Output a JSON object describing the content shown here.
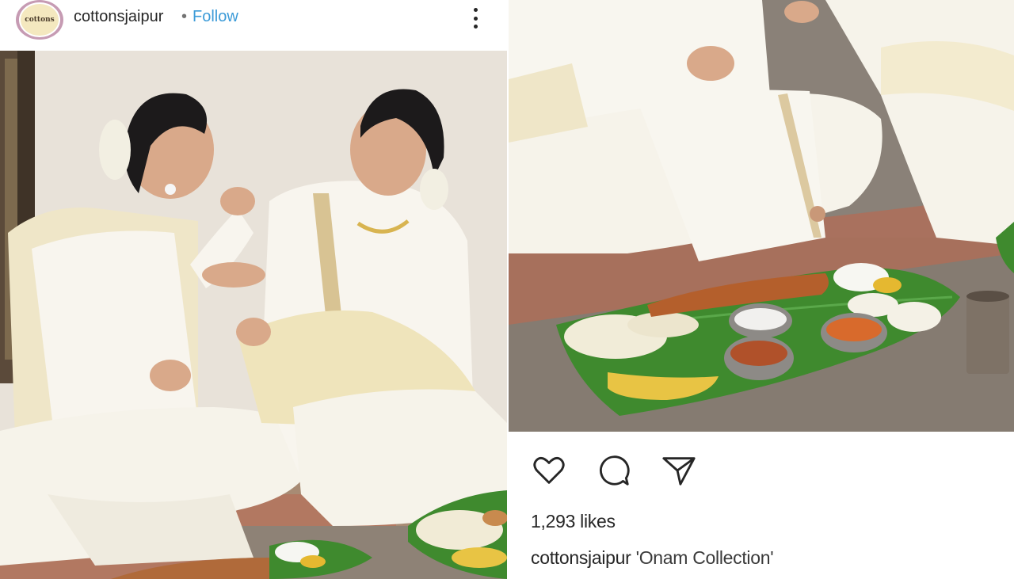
{
  "post": {
    "avatar_text": "cottons",
    "username": "cottonsjaipur",
    "separator": "•",
    "follow_label": "Follow"
  },
  "engagement": {
    "likes_text": "1,293 likes"
  },
  "caption": {
    "username": "cottonsjaipur",
    "text": "'Onam Collection'"
  },
  "icons": {
    "more": "more-options-icon",
    "like": "heart-icon",
    "comment": "comment-bubble-icon",
    "share": "paper-plane-icon"
  },
  "colors": {
    "follow_link": "#3c9bd8",
    "text": "#262626",
    "banana_leaf": "#3f8a2e",
    "outfit_cream": "#f6f1e3",
    "wall": "#e9e3da"
  }
}
